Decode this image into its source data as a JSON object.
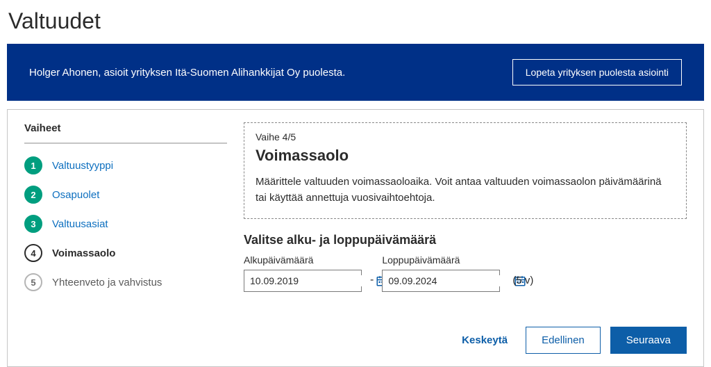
{
  "page_title": "Valtuudet",
  "banner": {
    "text": "Holger Ahonen, asioit yrityksen Itä-Suomen Alihankkijat Oy puolesta.",
    "stop_button": "Lopeta yrityksen puolesta asiointi"
  },
  "sidebar": {
    "title": "Vaiheet",
    "steps": [
      {
        "num": "1",
        "label": "Valtuustyyppi",
        "state": "done"
      },
      {
        "num": "2",
        "label": "Osapuolet",
        "state": "done"
      },
      {
        "num": "3",
        "label": "Valtuusasiat",
        "state": "done"
      },
      {
        "num": "4",
        "label": "Voimassaolo",
        "state": "current"
      },
      {
        "num": "5",
        "label": "Yhteenveto ja vahvistus",
        "state": "future"
      }
    ]
  },
  "main": {
    "step_indicator": "Vaihe 4/5",
    "title": "Voimassaolo",
    "description": "Määrittele valtuuden voimassaoloaika. Voit antaa valtuuden voimassaolon päivämäärinä tai käyttää annettuja vuosivaihtoehtoja.",
    "section_title": "Valitse alku- ja loppupäivämäärä",
    "start_label": "Alkupäivämäärä",
    "start_value": "10.09.2019",
    "end_label": "Loppupäivämäärä",
    "end_value": "09.09.2024",
    "dash": "-",
    "duration": "(5 v)"
  },
  "actions": {
    "cancel": "Keskeytä",
    "prev": "Edellinen",
    "next": "Seuraava"
  }
}
